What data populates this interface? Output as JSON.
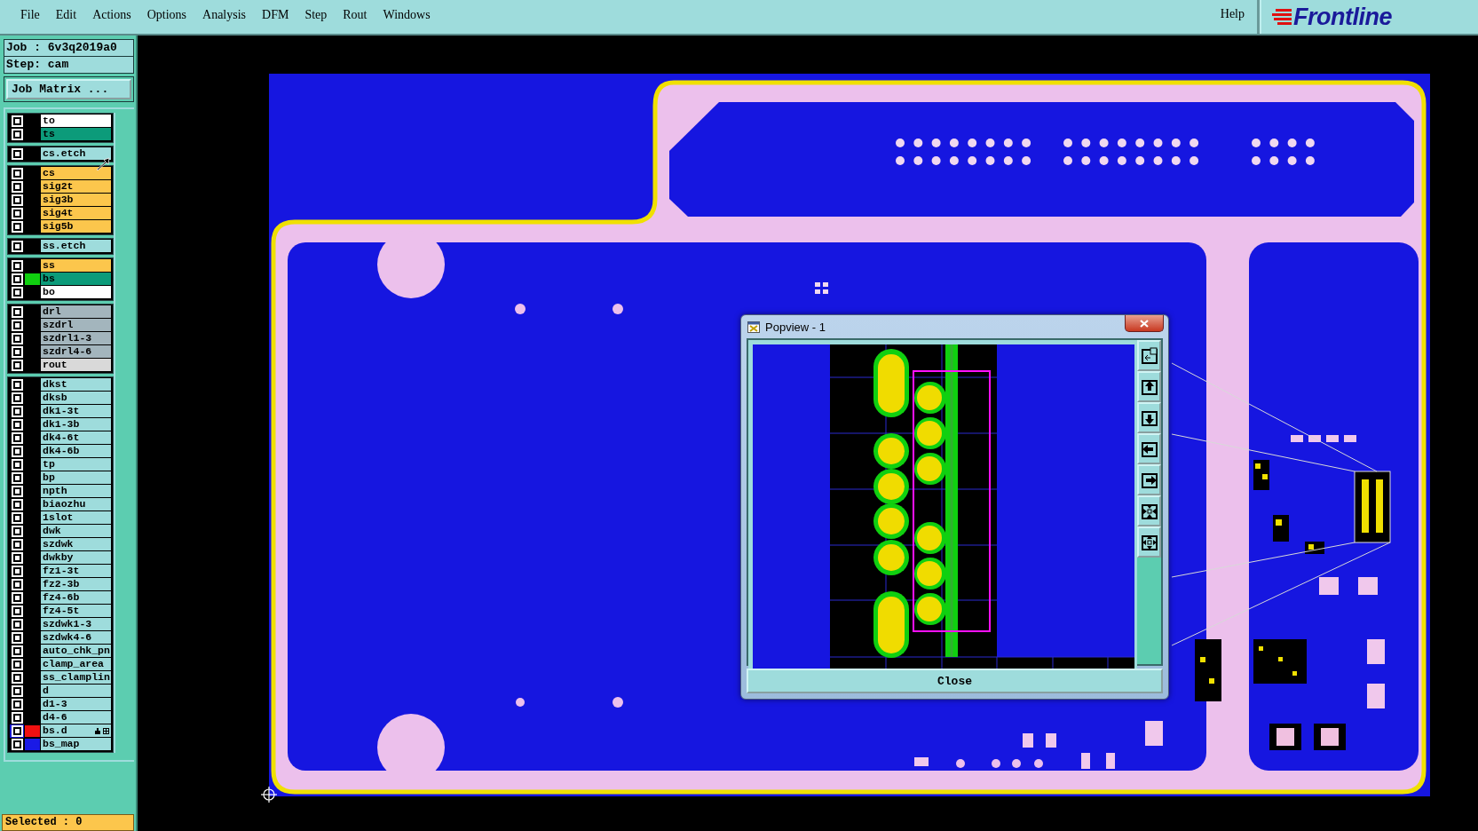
{
  "menu_bar": {
    "items": [
      {
        "label": "File"
      },
      {
        "label": "Edit"
      },
      {
        "label": "Actions"
      },
      {
        "label": "Options"
      },
      {
        "label": "Analysis"
      },
      {
        "label": "DFM"
      },
      {
        "label": "Step"
      },
      {
        "label": "Rout"
      },
      {
        "label": "Windows"
      }
    ],
    "help": "Help",
    "logo": "Frontline"
  },
  "job_panel": {
    "job": "Job : 6v3q2019a0",
    "step": "Step: cam",
    "matrix_button": "Job Matrix ..."
  },
  "layer_groups": [
    [
      {
        "name": "to",
        "color": "#ffffff",
        "selected": false
      },
      {
        "name": "ts",
        "color": "#0c9b7a",
        "selected": false
      }
    ],
    [
      {
        "name": "cs.etch",
        "color": "#9edcdc",
        "selected": false
      }
    ],
    [
      {
        "name": "cs",
        "color": "#fcc64c",
        "selected": false
      },
      {
        "name": "sig2t",
        "color": "#fcc64c",
        "selected": false
      },
      {
        "name": "sig3b",
        "color": "#fcc64c",
        "selected": false
      },
      {
        "name": "sig4t",
        "color": "#fcc64c",
        "selected": false
      },
      {
        "name": "sig5b",
        "color": "#fcc64c",
        "selected": false
      }
    ],
    [
      {
        "name": "ss.etch",
        "color": "#9edcdc",
        "selected": false
      }
    ],
    [
      {
        "name": "ss",
        "color": "#fcc64c",
        "selected": false
      },
      {
        "name": "bs",
        "color": "#0c9b7a",
        "selected": false,
        "swatch": {
          "color": "#10d010"
        }
      },
      {
        "name": "bo",
        "color": "#ffffff",
        "selected": false
      }
    ],
    [
      {
        "name": "drl",
        "color": "#a3b5bd",
        "selected": false
      },
      {
        "name": "szdrl",
        "color": "#a3b5bd",
        "selected": false
      },
      {
        "name": "szdrl1-3",
        "color": "#a3b5bd",
        "selected": false
      },
      {
        "name": "szdrl4-6",
        "color": "#a3b5bd",
        "selected": false
      },
      {
        "name": "rout",
        "color": "#d9d9d9",
        "selected": false
      }
    ],
    [
      {
        "name": "dkst",
        "color": "#9edcdc",
        "selected": false
      },
      {
        "name": "dksb",
        "color": "#9edcdc",
        "selected": false
      },
      {
        "name": "dk1-3t",
        "color": "#9edcdc",
        "selected": false
      },
      {
        "name": "dk1-3b",
        "color": "#9edcdc",
        "selected": false
      },
      {
        "name": "dk4-6t",
        "color": "#9edcdc",
        "selected": false
      },
      {
        "name": "dk4-6b",
        "color": "#9edcdc",
        "selected": false
      },
      {
        "name": "tp",
        "color": "#9edcdc",
        "selected": false
      },
      {
        "name": "bp",
        "color": "#9edcdc",
        "selected": false
      },
      {
        "name": "npth",
        "color": "#9edcdc",
        "selected": false
      },
      {
        "name": "biaozhu",
        "color": "#9edcdc",
        "selected": false
      },
      {
        "name": "1slot",
        "color": "#9edcdc",
        "selected": false
      },
      {
        "name": "dwk",
        "color": "#9edcdc",
        "selected": false
      },
      {
        "name": "szdwk",
        "color": "#9edcdc",
        "selected": false
      },
      {
        "name": "dwkby",
        "color": "#9edcdc",
        "selected": false
      },
      {
        "name": "fz1-3t",
        "color": "#9edcdc",
        "selected": false
      },
      {
        "name": "fz2-3b",
        "color": "#9edcdc",
        "selected": false
      },
      {
        "name": "fz4-6b",
        "color": "#9edcdc",
        "selected": false
      },
      {
        "name": "fz4-5t",
        "color": "#9edcdc",
        "selected": false
      },
      {
        "name": "szdwk1-3",
        "color": "#9edcdc",
        "selected": false
      },
      {
        "name": "szdwk4-6",
        "color": "#9edcdc",
        "selected": false
      },
      {
        "name": "auto_chk_pn",
        "color": "#9edcdc",
        "selected": false
      },
      {
        "name": "clamp_area",
        "color": "#9edcdc",
        "selected": false
      },
      {
        "name": "ss_clamplin",
        "color": "#9edcdc",
        "selected": false
      },
      {
        "name": "d",
        "color": "#9edcdc",
        "selected": false
      },
      {
        "name": "d1-3",
        "color": "#9edcdc",
        "selected": false
      },
      {
        "name": "d4-6",
        "color": "#9edcdc",
        "selected": false
      },
      {
        "name": "bs.d",
        "color": "#9edcdc",
        "selected": true,
        "swatch": {
          "color": "#f01010"
        }
      },
      {
        "name": "bs_map",
        "color": "#9edcdc",
        "selected": false,
        "swatch": {
          "color": "#1a1ae6"
        }
      }
    ]
  ],
  "status": "Selected : 0",
  "popview": {
    "title": "Popview - 1",
    "close_button": "Close"
  }
}
